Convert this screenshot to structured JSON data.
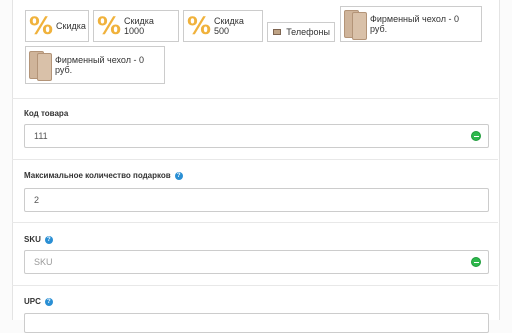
{
  "gifts": [
    {
      "label": "Скидка",
      "icon": "percent-icon"
    },
    {
      "label": "Скидка 1000",
      "icon": "percent-icon"
    },
    {
      "label": "Скидка 500",
      "icon": "percent-icon"
    },
    {
      "label": "Телефоны",
      "icon": "phone-icon"
    },
    {
      "label": "Фирменный чехол - 0 руб.",
      "icon": "phone-case-icon"
    },
    {
      "label": "Фирменный чехол - 0 руб.",
      "icon": "phone-case-icon"
    }
  ],
  "percent_symbol": "%",
  "fields": {
    "product_code": {
      "label": "Код товара",
      "value": "111",
      "status_icon": "check-circle-icon"
    },
    "max_gifts": {
      "label": "Максимальное количество подарков",
      "value": "2",
      "help_icon": "question-circle-icon"
    },
    "sku": {
      "label": "SKU",
      "value": "",
      "placeholder": "SKU",
      "help_icon": "question-circle-icon",
      "status_icon": "check-circle-icon"
    },
    "upc": {
      "label": "UPC",
      "help_icon": "question-circle-icon"
    }
  },
  "help_glyph": "?",
  "colors": {
    "percent": "#f0b23c",
    "help": "#2a8fd4",
    "ok": "#2db84c"
  }
}
